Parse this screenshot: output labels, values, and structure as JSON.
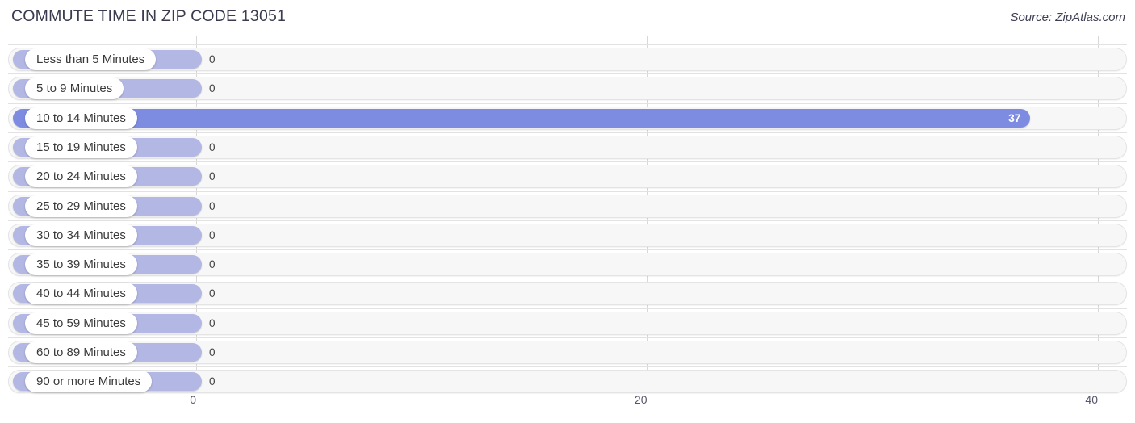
{
  "header": {
    "title": "COMMUTE TIME IN ZIP CODE 13051",
    "source": "Source: ZipAtlas.com"
  },
  "colors": {
    "bar_default": "#b3b7e4",
    "bar_highlight": "#7d8ce0",
    "track": "#f7f7f7",
    "gridline": "#d8d8d8",
    "title_text": "#3b3b4f",
    "value_text_inside": "#ffffff",
    "value_text_outside": "#3d3d3d"
  },
  "chart_data": {
    "type": "bar",
    "orientation": "horizontal",
    "title": "COMMUTE TIME IN ZIP CODE 13051",
    "subtitle": "Source: ZipAtlas.com",
    "xlabel": "",
    "ylabel": "",
    "xlim": [
      0,
      40
    ],
    "grid": true,
    "legend": "none",
    "xticks": [
      "0",
      "20",
      "40"
    ],
    "xtick_values": [
      0,
      20,
      40
    ],
    "categories": [
      "Less than 5 Minutes",
      "5 to 9 Minutes",
      "10 to 14 Minutes",
      "15 to 19 Minutes",
      "20 to 24 Minutes",
      "25 to 29 Minutes",
      "30 to 34 Minutes",
      "35 to 39 Minutes",
      "40 to 44 Minutes",
      "45 to 59 Minutes",
      "60 to 89 Minutes",
      "90 or more Minutes"
    ],
    "values": [
      0,
      0,
      37,
      0,
      0,
      0,
      0,
      0,
      0,
      0,
      0,
      0
    ],
    "value_labels": [
      "0",
      "0",
      "37",
      "0",
      "0",
      "0",
      "0",
      "0",
      "0",
      "0",
      "0",
      "0"
    ],
    "highlight_index": 2
  },
  "rows": [
    {
      "label": "Less than 5 Minutes",
      "value": 0,
      "value_label": "0",
      "highlight": false
    },
    {
      "label": "5 to 9 Minutes",
      "value": 0,
      "value_label": "0",
      "highlight": false
    },
    {
      "label": "10 to 14 Minutes",
      "value": 37,
      "value_label": "37",
      "highlight": true
    },
    {
      "label": "15 to 19 Minutes",
      "value": 0,
      "value_label": "0",
      "highlight": false
    },
    {
      "label": "20 to 24 Minutes",
      "value": 0,
      "value_label": "0",
      "highlight": false
    },
    {
      "label": "25 to 29 Minutes",
      "value": 0,
      "value_label": "0",
      "highlight": false
    },
    {
      "label": "30 to 34 Minutes",
      "value": 0,
      "value_label": "0",
      "highlight": false
    },
    {
      "label": "35 to 39 Minutes",
      "value": 0,
      "value_label": "0",
      "highlight": false
    },
    {
      "label": "40 to 44 Minutes",
      "value": 0,
      "value_label": "0",
      "highlight": false
    },
    {
      "label": "45 to 59 Minutes",
      "value": 0,
      "value_label": "0",
      "highlight": false
    },
    {
      "label": "60 to 89 Minutes",
      "value": 0,
      "value_label": "0",
      "highlight": false
    },
    {
      "label": "90 or more Minutes",
      "value": 0,
      "value_label": "0",
      "highlight": false
    }
  ]
}
